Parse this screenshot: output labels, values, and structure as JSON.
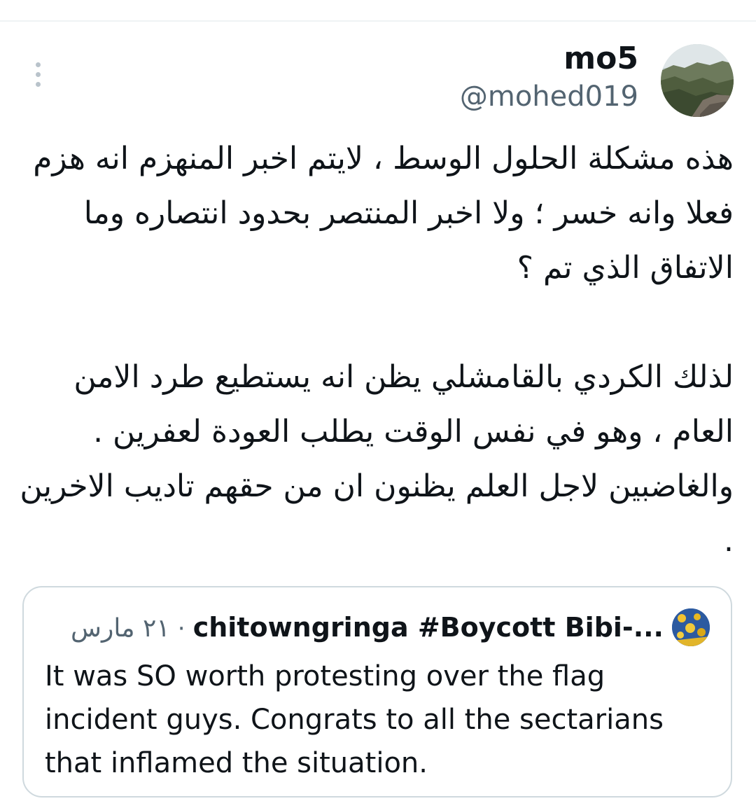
{
  "tweet": {
    "author": {
      "display_name": "mo5",
      "handle": "@mohed019"
    },
    "text_paragraph_1": "هذه مشكلة الحلول الوسط ، لايتم اخبر المنهزم انه هزم فعلا وانه خسر ؛ ولا اخبر المنتصر بحدود انتصاره وما الاتفاق الذي تم ؟",
    "text_paragraph_2": "لذلك الكردي بالقامشلي يظن انه يستطيع طرد الامن العام ، وهو في نفس الوقت يطلب العودة لعفرين .\nوالغاضبين لاجل العلم يظنون ان من حقهم تاديب الاخرين ."
  },
  "quote": {
    "author_display": "chitowngringa #Boycott Bibi-...",
    "separator": "·",
    "date": "٢١ مارس",
    "text": "It was SO worth protesting over the flag incident guys.  Congrats to all the sectarians that inflamed the situation."
  },
  "icons": {
    "more": "vertical-dots-icon"
  },
  "colors": {
    "text_primary": "#0f1419",
    "text_secondary": "#536471",
    "border": "#cfd9de",
    "icon_muted": "#b9c3cb"
  }
}
